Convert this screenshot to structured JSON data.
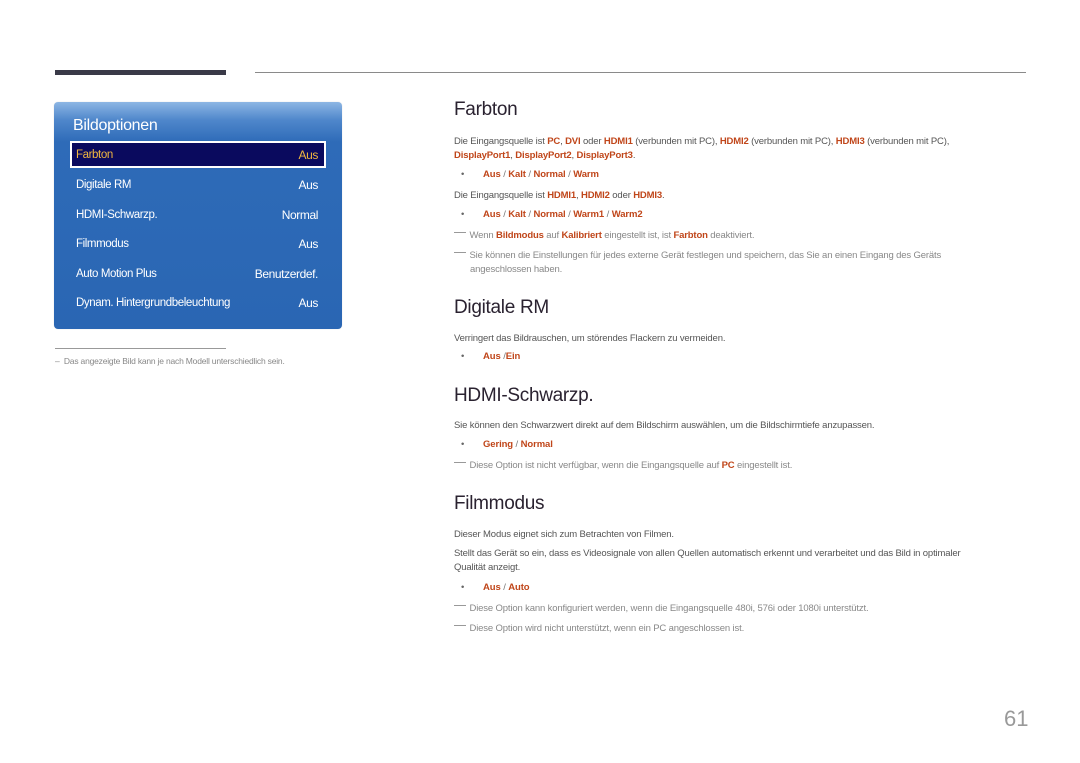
{
  "panel": {
    "title": "Bildoptionen",
    "items": [
      {
        "label": "Farbton",
        "value": "Aus",
        "selected": true
      },
      {
        "label": "Digitale RM",
        "value": "Aus"
      },
      {
        "label": "HDMI-Schwarzp.",
        "value": "Normal"
      },
      {
        "label": "Filmmodus",
        "value": "Aus"
      },
      {
        "label": "Auto Motion Plus",
        "value": "Benutzerdef."
      },
      {
        "label": "Dynam. Hintergrundbeleuchtung",
        "value": "Aus"
      }
    ]
  },
  "footnote": {
    "dash": "–",
    "text": "Das angezeigte Bild kann je nach Modell unterschiedlich sein."
  },
  "sections": {
    "farbton": {
      "title": "Farbton",
      "p1": {
        "t1": "Die Eingangsquelle ist ",
        "pc": "PC",
        "c1": ", ",
        "dvi": "DVI",
        "t2": " oder ",
        "hdmi1": "HDMI1",
        "t3": " (verbunden mit PC), ",
        "hdmi2": "HDMI2",
        "t4": " (verbunden mit PC), ",
        "hdmi3": "HDMI3",
        "t5": " (verbunden mit PC),",
        "dp1": "DisplayPort1",
        "c2": ", ",
        "dp2": "DisplayPort2",
        "c3": ", ",
        "dp3": "DisplayPort3",
        "end": "."
      },
      "options1": [
        "Aus",
        "Kalt",
        "Normal",
        "Warm"
      ],
      "p2": {
        "t1": "Die Eingangsquelle ist ",
        "hdmi1": "HDMI1",
        "c1": ", ",
        "hdmi2": "HDMI2",
        "t2": " oder ",
        "hdmi3": "HDMI3",
        "end": "."
      },
      "options2": [
        "Aus",
        "Kalt",
        "Normal",
        "Warm1",
        "Warm2"
      ],
      "note1": {
        "t1": "Wenn ",
        "b1": "Bildmodus",
        "t2": " auf ",
        "b2": "Kalibriert",
        "t3": " eingestellt ist, ist ",
        "b3": "Farbton",
        "t4": " deaktiviert."
      },
      "note2": {
        "line1": "Sie können die Einstellungen für jedes externe Gerät festlegen und speichern, das Sie an einen Eingang des Geräts",
        "line2": "angeschlossen haben."
      }
    },
    "digitale_rm": {
      "title": "Digitale RM",
      "p1": "Verringert das Bildrauschen, um störendes Flackern zu vermeiden.",
      "options": [
        "Aus",
        "Ein"
      ]
    },
    "hdmi_schwarzp": {
      "title": "HDMI-Schwarzp.",
      "p1": "Sie können den Schwarzwert direkt auf dem Bildschirm auswählen, um die Bildschirmtiefe anzupassen.",
      "options": [
        "Gering",
        "Normal"
      ],
      "note1": {
        "t1": "Diese Option ist nicht verfügbar, wenn die Eingangsquelle auf ",
        "b1": "PC",
        "t2": " eingestellt ist."
      }
    },
    "filmmodus": {
      "title": "Filmmodus",
      "p1": "Dieser Modus eignet sich zum Betrachten von Filmen.",
      "p2_line1": "Stellt das Gerät so ein, dass es Videosignale von allen Quellen automatisch erkennt und verarbeitet und das Bild in optimaler",
      "p2_line2": "Qualität anzeigt.",
      "options": [
        "Aus",
        "Auto"
      ],
      "note1": "Diese Option kann konfiguriert werden, wenn die Eingangsquelle 480i, 576i oder 1080i unterstützt.",
      "note2": "Diese Option wird nicht unterstützt, wenn ein PC angeschlossen ist."
    }
  },
  "page_number": "61",
  "colors": {
    "accent_red": "#c0461a",
    "panel_blue": "#2a66b3",
    "selected_bg": "#0a0a5e",
    "selected_text": "#f0b640"
  }
}
